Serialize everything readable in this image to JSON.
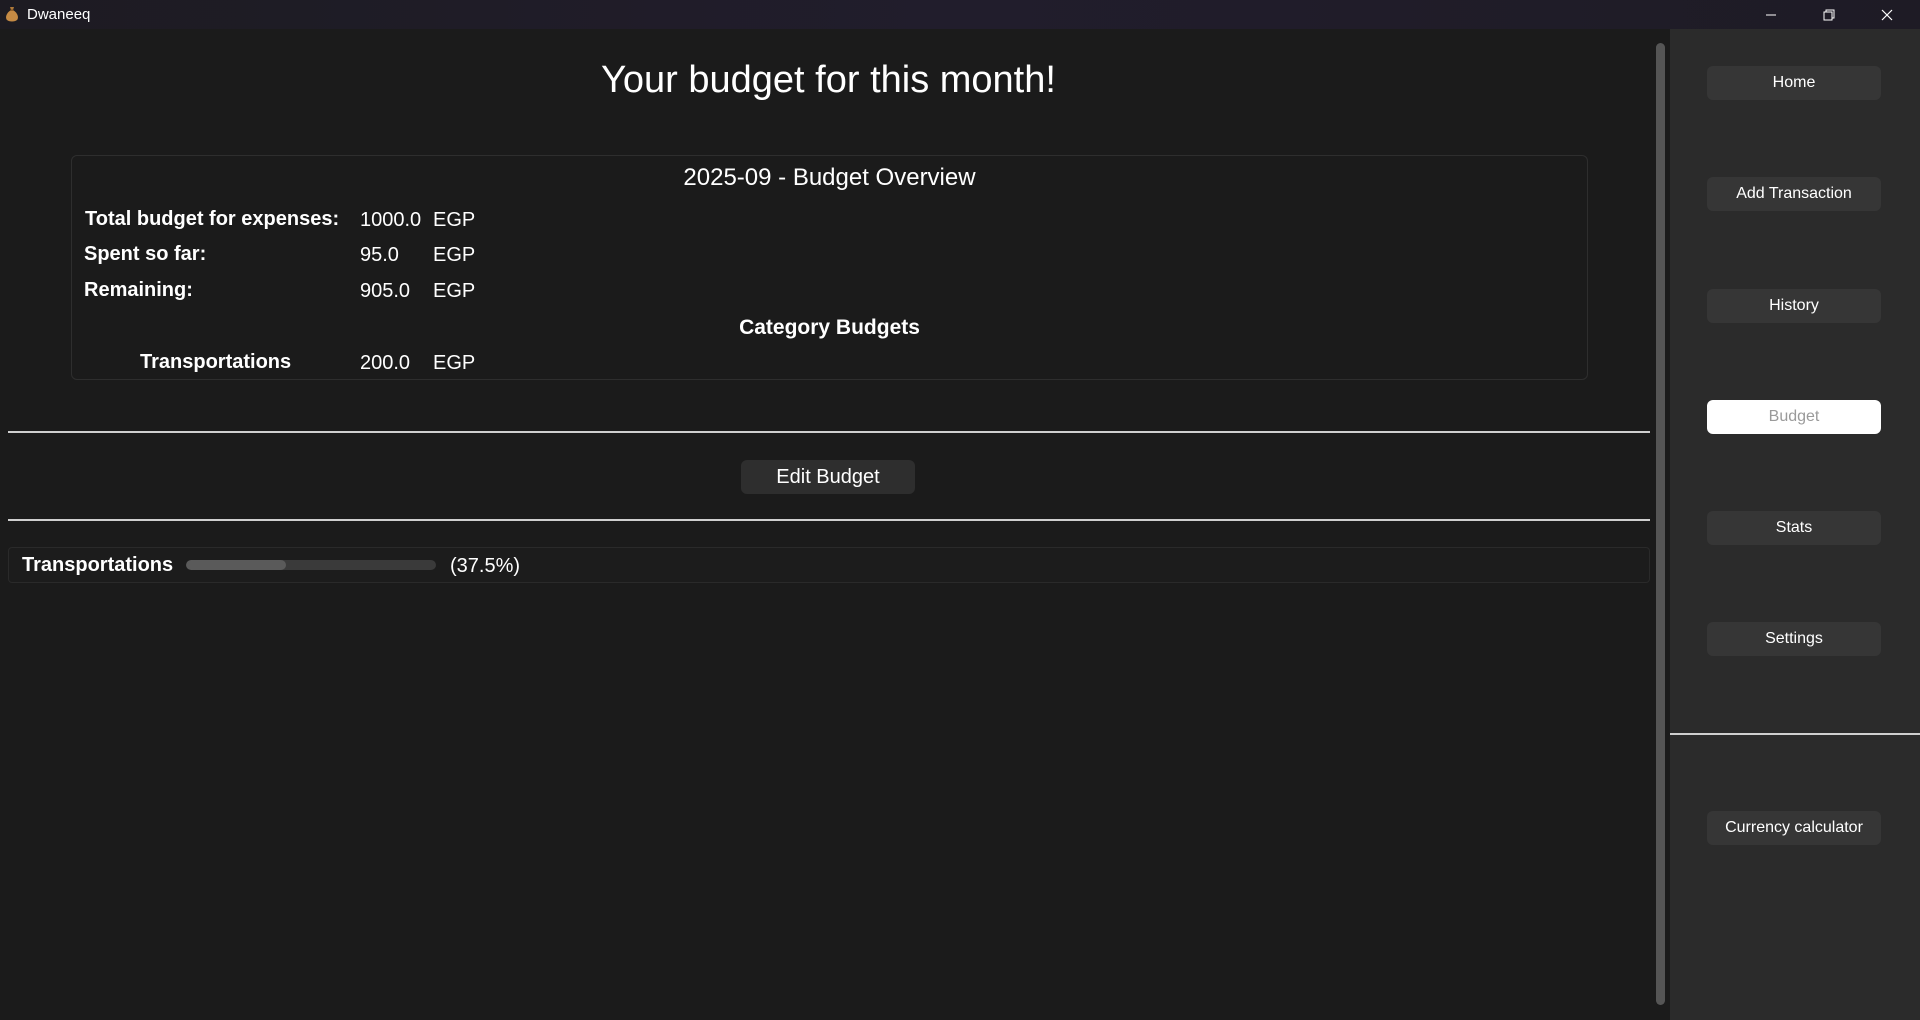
{
  "window": {
    "title": "Dwaneeq"
  },
  "main": {
    "page_title": "Your budget for this month!",
    "overview": {
      "title": "2025-09 - Budget Overview",
      "rows": [
        {
          "label": "Total budget for expenses:",
          "value": "1000.0",
          "unit": "EGP"
        },
        {
          "label": "Spent so far:",
          "value": "95.0",
          "unit": "EGP"
        },
        {
          "label": "Remaining:",
          "value": "905.0",
          "unit": "EGP"
        }
      ],
      "category_heading": "Category Budgets",
      "categories": [
        {
          "label": "Transportations",
          "value": "200.0",
          "unit": "EGP"
        }
      ]
    },
    "edit_button": "Edit Budget",
    "progress": [
      {
        "label": "Transportations",
        "percent_text": "(37.5%)",
        "fill_fraction": 0.4,
        "fill_color": "#5a5a5a"
      }
    ]
  },
  "sidebar": {
    "nav": [
      {
        "label": "Home",
        "active": false
      },
      {
        "label": "Add Transaction",
        "active": false
      },
      {
        "label": "History",
        "active": false
      },
      {
        "label": "Budget",
        "active": true
      },
      {
        "label": "Stats",
        "active": false
      },
      {
        "label": "Settings",
        "active": false
      }
    ],
    "currency_calculator": "Currency calculator"
  },
  "icons": {
    "app": "money-bag-icon",
    "minimize": "minimize-icon",
    "maximize": "restore-icon",
    "close": "close-icon"
  }
}
